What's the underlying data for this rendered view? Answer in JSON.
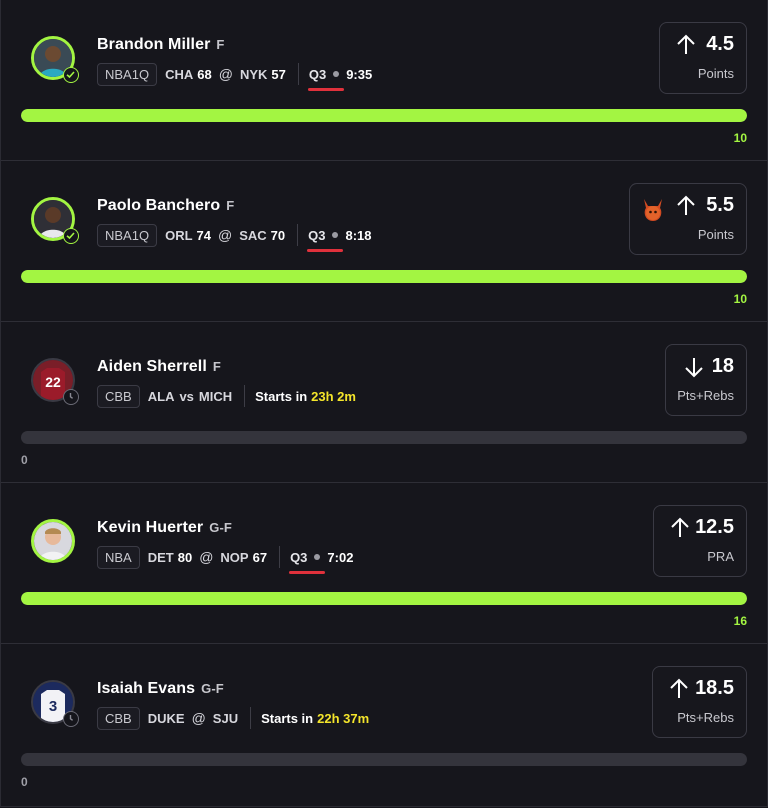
{
  "picks": [
    {
      "player": "Brandon Miller",
      "position": "F",
      "league": "NBA1Q",
      "away_team": "CHA",
      "away_score": "68",
      "home_team": "NYK",
      "home_score": "57",
      "quarter": "Q3",
      "game_clock": "9:35",
      "direction": "up",
      "line": "4.5",
      "stat": "Points",
      "progress_value": "10",
      "progress_fraction": 1.0,
      "status": "live"
    },
    {
      "player": "Paolo Banchero",
      "position": "F",
      "league": "NBA1Q",
      "away_team": "ORL",
      "away_score": "74",
      "home_team": "SAC",
      "home_score": "70",
      "quarter": "Q3",
      "game_clock": "8:18",
      "direction": "up",
      "line": "5.5",
      "stat": "Points",
      "progress_value": "10",
      "progress_fraction": 1.0,
      "status": "live",
      "demon": true
    },
    {
      "player": "Aiden Sherrell",
      "position": "F",
      "league": "CBB",
      "away_team": "ALA",
      "home_team": "MICH",
      "matchup_sep": "vs",
      "starts_label": "Starts in",
      "countdown": "23h 2m",
      "direction": "down",
      "line": "18",
      "stat": "Pts+Rebs",
      "progress_value": "0",
      "progress_fraction": 0.0,
      "status": "upcoming",
      "jersey_number": "22"
    },
    {
      "player": "Kevin Huerter",
      "position": "G-F",
      "league": "NBA",
      "away_team": "DET",
      "away_score": "80",
      "home_team": "NOP",
      "home_score": "67",
      "quarter": "Q3",
      "game_clock": "7:02",
      "direction": "up",
      "line": "12.5",
      "stat": "PRA",
      "progress_value": "16",
      "progress_fraction": 1.0,
      "status": "live"
    },
    {
      "player": "Isaiah Evans",
      "position": "G-F",
      "league": "CBB",
      "away_team": "DUKE",
      "home_team": "SJU",
      "matchup_sep": "@",
      "starts_label": "Starts in",
      "countdown": "22h 37m",
      "direction": "up",
      "line": "18.5",
      "stat": "Pts+Rebs",
      "progress_value": "0",
      "progress_fraction": 0.0,
      "status": "upcoming",
      "jersey_number": "3"
    }
  ],
  "colors": {
    "accent": "#a3f542",
    "countdown": "#f4e52b",
    "quarter_underline": "#e0313c",
    "background": "#16161c"
  }
}
